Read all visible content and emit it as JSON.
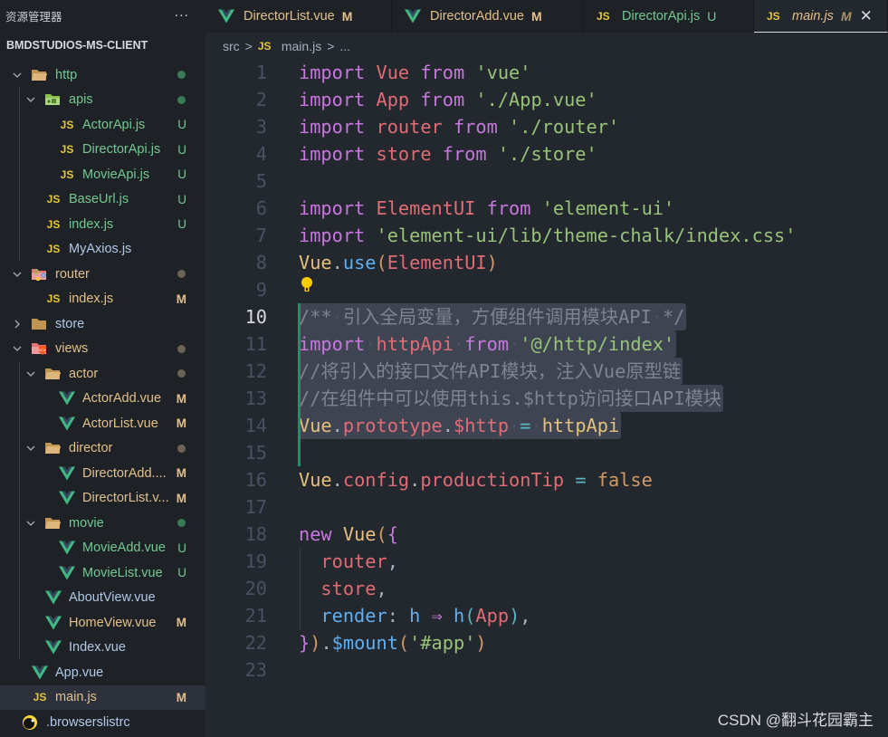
{
  "sidebar": {
    "title": "资源管理器",
    "more": "···",
    "project": "BMDSTUDIOS-MS-CLIENT",
    "tree": [
      {
        "label": "http",
        "type": "folder",
        "folder_style": "plain",
        "depth": 0,
        "expanded": true,
        "status": "dot-green",
        "color": "green"
      },
      {
        "label": "apis",
        "type": "folder",
        "folder_style": "api",
        "depth": 1,
        "expanded": true,
        "status": "dot-green",
        "color": "green"
      },
      {
        "label": "ActorApi.js",
        "type": "js",
        "depth": 2,
        "status": "U",
        "color": "green"
      },
      {
        "label": "DirectorApi.js",
        "type": "js",
        "depth": 2,
        "status": "U",
        "color": "green"
      },
      {
        "label": "MovieApi.js",
        "type": "js",
        "depth": 2,
        "status": "U",
        "color": "green"
      },
      {
        "label": "BaseUrl.js",
        "type": "js",
        "depth": 1,
        "status": "U",
        "color": "green"
      },
      {
        "label": "index.js",
        "type": "js",
        "depth": 1,
        "status": "U",
        "color": "green"
      },
      {
        "label": "MyAxios.js",
        "type": "js",
        "depth": 1,
        "status": "",
        "color": "norm"
      },
      {
        "label": "router",
        "type": "folder",
        "folder_style": "router",
        "depth": 0,
        "expanded": true,
        "status": "dot-mod",
        "color": "mod"
      },
      {
        "label": "index.js",
        "type": "js",
        "depth": 1,
        "status": "M",
        "color": "mod"
      },
      {
        "label": "store",
        "type": "folder",
        "folder_style": "closed",
        "depth": 0,
        "expanded": false,
        "status": "",
        "color": "norm"
      },
      {
        "label": "views",
        "type": "folder",
        "folder_style": "views",
        "depth": 0,
        "expanded": true,
        "status": "dot-mod",
        "color": "mod"
      },
      {
        "label": "actor",
        "type": "folder",
        "folder_style": "plain",
        "depth": 1,
        "expanded": true,
        "status": "dot-mod",
        "color": "mod"
      },
      {
        "label": "ActorAdd.vue",
        "type": "vue",
        "depth": 2,
        "status": "M",
        "color": "mod"
      },
      {
        "label": "ActorList.vue",
        "type": "vue",
        "depth": 2,
        "status": "M",
        "color": "mod"
      },
      {
        "label": "director",
        "type": "folder",
        "folder_style": "plain",
        "depth": 1,
        "expanded": true,
        "status": "dot-mod",
        "color": "mod"
      },
      {
        "label": "DirectorAdd....",
        "type": "vue",
        "depth": 2,
        "status": "M",
        "color": "mod"
      },
      {
        "label": "DirectorList.v...",
        "type": "vue",
        "depth": 2,
        "status": "M",
        "color": "mod"
      },
      {
        "label": "movie",
        "type": "folder",
        "folder_style": "plain",
        "depth": 1,
        "expanded": true,
        "status": "dot-green",
        "color": "green"
      },
      {
        "label": "MovieAdd.vue",
        "type": "vue",
        "depth": 2,
        "status": "U",
        "color": "green"
      },
      {
        "label": "MovieList.vue",
        "type": "vue",
        "depth": 2,
        "status": "U",
        "color": "green"
      },
      {
        "label": "AboutView.vue",
        "type": "vue",
        "depth": 1,
        "status": "",
        "color": "norm"
      },
      {
        "label": "HomeView.vue",
        "type": "vue",
        "depth": 1,
        "status": "M",
        "color": "mod"
      },
      {
        "label": "Index.vue",
        "type": "vue",
        "depth": 1,
        "status": "",
        "color": "norm"
      },
      {
        "label": "App.vue",
        "type": "vue",
        "depth": 0,
        "status": "",
        "color": "norm"
      },
      {
        "label": "main.js",
        "type": "js",
        "depth": 0,
        "status": "M",
        "color": "mod",
        "selected": true
      },
      {
        "label": ".browserslistrc",
        "type": "browserslist",
        "depth": -1,
        "status": "",
        "color": "norm"
      }
    ]
  },
  "tabs": [
    {
      "label": "DirectorList.vue",
      "icon": "vue",
      "status": "M",
      "color": "mod",
      "active": false
    },
    {
      "label": "DirectorAdd.vue",
      "icon": "vue",
      "status": "M",
      "color": "mod",
      "active": false
    },
    {
      "label": "DirectorApi.js",
      "icon": "js",
      "status": "U",
      "color": "green",
      "active": false
    },
    {
      "label": "main.js",
      "icon": "js",
      "status": "M",
      "color": "mod",
      "active": true,
      "close": "✕"
    }
  ],
  "breadcrumb": {
    "folder": "src",
    "file": "main.js",
    "tail": "...",
    "js_label": "JS",
    "sep": ">"
  },
  "editor": {
    "current_line": 10,
    "lines": [
      {
        "n": 1,
        "tokens": [
          [
            "k",
            "import"
          ],
          [
            "p",
            " "
          ],
          [
            "v",
            "Vue"
          ],
          [
            "p",
            " "
          ],
          [
            "k",
            "from"
          ],
          [
            "p",
            " "
          ],
          [
            "s",
            "'vue'"
          ]
        ]
      },
      {
        "n": 2,
        "tokens": [
          [
            "k",
            "import"
          ],
          [
            "p",
            " "
          ],
          [
            "v",
            "App"
          ],
          [
            "p",
            " "
          ],
          [
            "k",
            "from"
          ],
          [
            "p",
            " "
          ],
          [
            "s",
            "'./App.vue'"
          ]
        ]
      },
      {
        "n": 3,
        "tokens": [
          [
            "k",
            "import"
          ],
          [
            "p",
            " "
          ],
          [
            "v",
            "router"
          ],
          [
            "p",
            " "
          ],
          [
            "k",
            "from"
          ],
          [
            "p",
            " "
          ],
          [
            "s",
            "'./router'"
          ]
        ]
      },
      {
        "n": 4,
        "tokens": [
          [
            "k",
            "import"
          ],
          [
            "p",
            " "
          ],
          [
            "v",
            "store"
          ],
          [
            "p",
            " "
          ],
          [
            "k",
            "from"
          ],
          [
            "p",
            " "
          ],
          [
            "s",
            "'./store'"
          ]
        ]
      },
      {
        "n": 5,
        "tokens": []
      },
      {
        "n": 6,
        "tokens": [
          [
            "k",
            "import"
          ],
          [
            "p",
            " "
          ],
          [
            "v",
            "ElementUI"
          ],
          [
            "p",
            " "
          ],
          [
            "k",
            "from"
          ],
          [
            "p",
            " "
          ],
          [
            "s",
            "'element-ui'"
          ]
        ]
      },
      {
        "n": 7,
        "tokens": [
          [
            "k",
            "import"
          ],
          [
            "p",
            " "
          ],
          [
            "s",
            "'element-ui/lib/theme-chalk/index.css'"
          ]
        ]
      },
      {
        "n": 8,
        "tokens": [
          [
            "cls",
            "Vue"
          ],
          [
            "p",
            "."
          ],
          [
            "fn",
            "use"
          ],
          [
            "br1",
            "("
          ],
          [
            "v",
            "ElementUI"
          ],
          [
            "br1",
            ")"
          ]
        ]
      },
      {
        "n": 9,
        "tokens": [],
        "lightbulb": true
      },
      {
        "n": 10,
        "sel": true,
        "tokens": [
          [
            "cm",
            "/**"
          ],
          [
            "ws",
            "·"
          ],
          [
            "cm",
            "引入全局变量，方便组件调用模块API"
          ],
          [
            "ws",
            "·"
          ],
          [
            "cm",
            "*/"
          ]
        ]
      },
      {
        "n": 11,
        "sel": true,
        "tokens": [
          [
            "k",
            "import"
          ],
          [
            "ws",
            "·"
          ],
          [
            "v",
            "httpApi"
          ],
          [
            "ws",
            "·"
          ],
          [
            "k",
            "from"
          ],
          [
            "ws",
            "·"
          ],
          [
            "s",
            "'@/http/index'"
          ]
        ]
      },
      {
        "n": 12,
        "sel": true,
        "tokens": [
          [
            "cm",
            "//将引入的接口文件API模块，注入Vue原型链"
          ]
        ]
      },
      {
        "n": 13,
        "sel": true,
        "tokens": [
          [
            "cm",
            "//在组件中可以使用this.$http访问接口API模块"
          ]
        ]
      },
      {
        "n": 14,
        "sel": true,
        "tokens": [
          [
            "cls",
            "Vue"
          ],
          [
            "p",
            "."
          ],
          [
            "v",
            "prototype"
          ],
          [
            "p",
            "."
          ],
          [
            "v",
            "$http"
          ],
          [
            "ws",
            "·"
          ],
          [
            "op",
            "="
          ],
          [
            "ws",
            "·"
          ],
          [
            "cls",
            "httpApi"
          ]
        ]
      },
      {
        "n": 15,
        "tokens": []
      },
      {
        "n": 16,
        "tokens": [
          [
            "cls",
            "Vue"
          ],
          [
            "p",
            "."
          ],
          [
            "v",
            "config"
          ],
          [
            "p",
            "."
          ],
          [
            "v",
            "productionTip"
          ],
          [
            "p",
            " "
          ],
          [
            "op",
            "="
          ],
          [
            "p",
            " "
          ],
          [
            "bool",
            "false"
          ]
        ]
      },
      {
        "n": 17,
        "tokens": []
      },
      {
        "n": 18,
        "tokens": [
          [
            "k",
            "new"
          ],
          [
            "p",
            " "
          ],
          [
            "cls",
            "Vue"
          ],
          [
            "br1",
            "("
          ],
          [
            "br2",
            "{"
          ]
        ]
      },
      {
        "n": 19,
        "tokens": [
          [
            "p",
            "  "
          ],
          [
            "v",
            "router"
          ],
          [
            "p",
            ","
          ]
        ]
      },
      {
        "n": 20,
        "tokens": [
          [
            "p",
            "  "
          ],
          [
            "v",
            "store"
          ],
          [
            "p",
            ","
          ]
        ]
      },
      {
        "n": 21,
        "tokens": [
          [
            "p",
            "  "
          ],
          [
            "fn",
            "render"
          ],
          [
            "p",
            ": "
          ],
          [
            "fn",
            "h"
          ],
          [
            "p",
            " "
          ],
          [
            "k",
            "⇒"
          ],
          [
            "p",
            " "
          ],
          [
            "fn",
            "h"
          ],
          [
            "br3",
            "("
          ],
          [
            "v",
            "App"
          ],
          [
            "br3",
            ")"
          ],
          [
            "p",
            ","
          ]
        ]
      },
      {
        "n": 22,
        "tokens": [
          [
            "br2",
            "}"
          ],
          [
            "br1",
            ")"
          ],
          [
            "p",
            "."
          ],
          [
            "fn",
            "$mount"
          ],
          [
            "br1",
            "("
          ],
          [
            "s",
            "'#app'"
          ],
          [
            "br1",
            ")"
          ]
        ]
      },
      {
        "n": 23,
        "tokens": []
      }
    ]
  },
  "watermark": "CSDN @翻斗花园霸主",
  "colors": {
    "untracked": "#73c991",
    "modified": "#e2c08d",
    "normal": "#b1c8e8",
    "accent_gutter": "#109868",
    "js_icon": "#e5c83b",
    "vue_icon": "#41b883"
  }
}
